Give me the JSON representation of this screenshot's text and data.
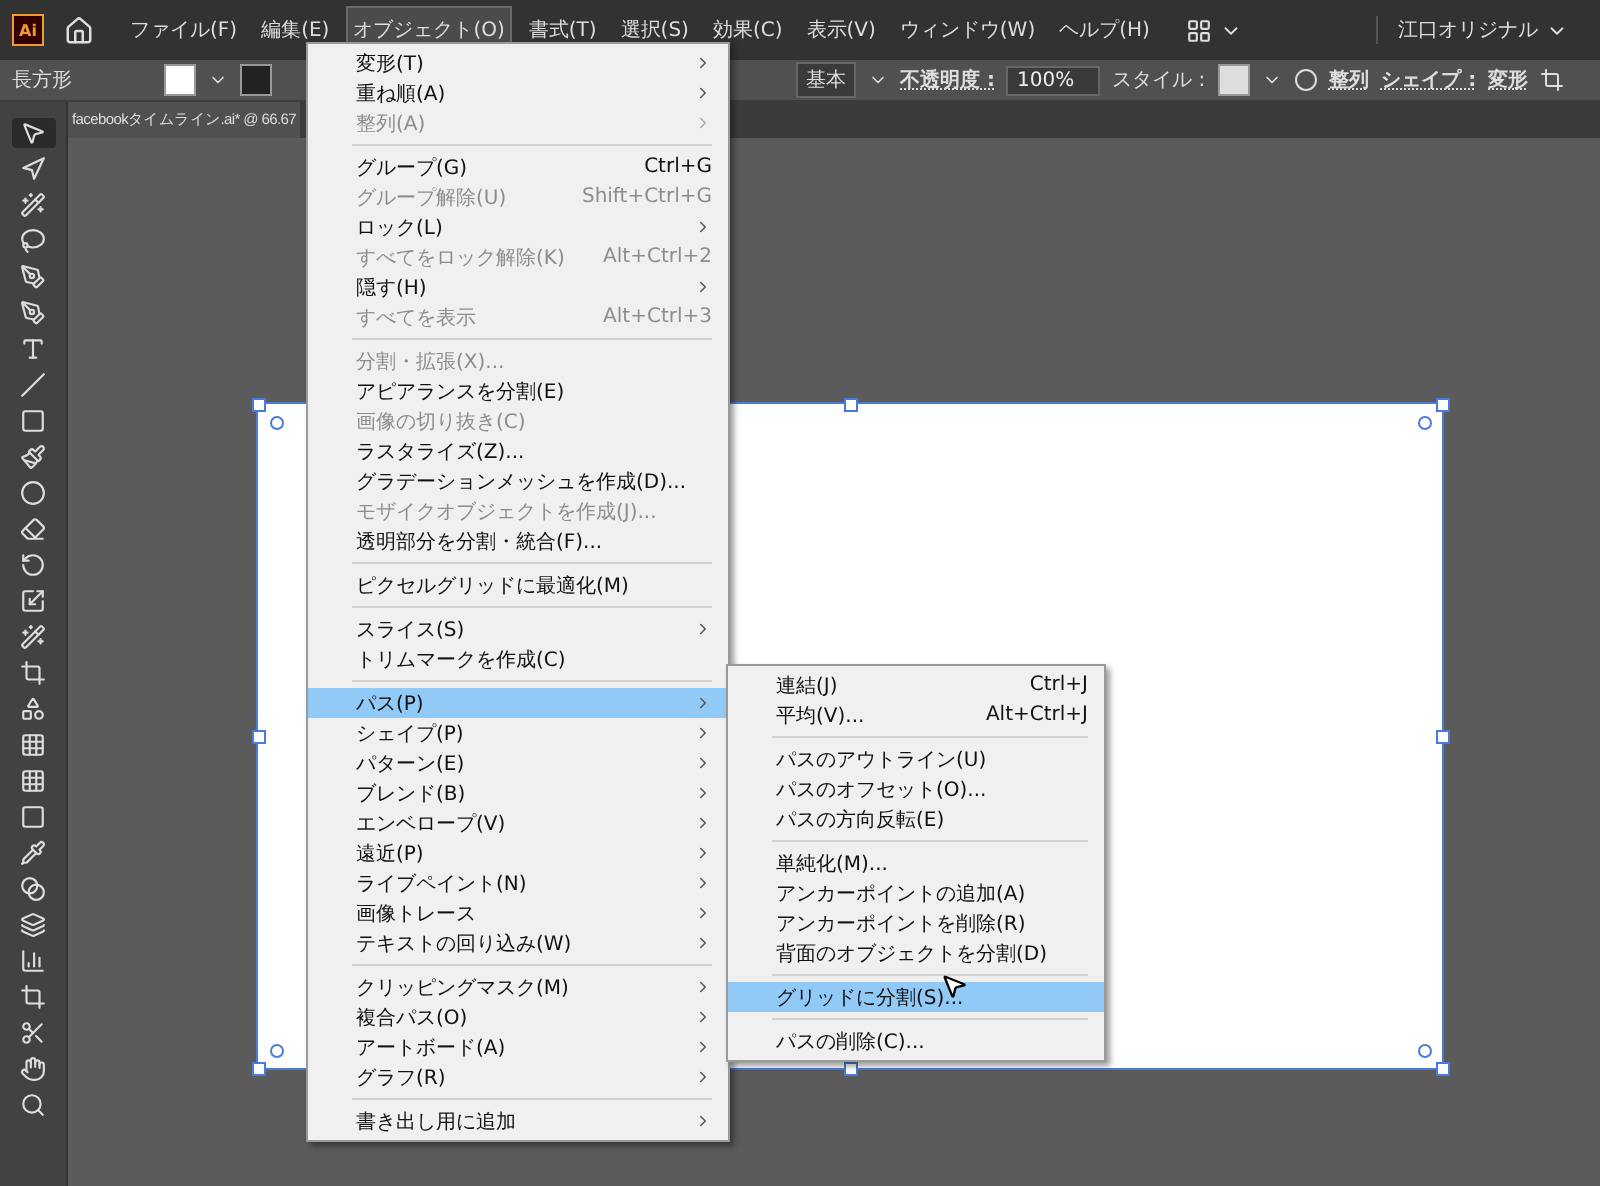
{
  "app_logo": "Ai",
  "menubar": {
    "menus": [
      {
        "label": "ファイル(F)",
        "selected": false
      },
      {
        "label": "編集(E)",
        "selected": false
      },
      {
        "label": "オブジェクト(O)",
        "selected": true
      },
      {
        "label": "書式(T)",
        "selected": false
      },
      {
        "label": "選択(S)",
        "selected": false
      },
      {
        "label": "効果(C)",
        "selected": false
      },
      {
        "label": "表示(V)",
        "selected": false
      },
      {
        "label": "ウィンドウ(W)",
        "selected": false
      },
      {
        "label": "ヘルプ(H)",
        "selected": false
      }
    ],
    "workspace": "江口オリジナル"
  },
  "control_bar": {
    "tool_name": "長方形",
    "brush": "基本",
    "opacity_label": "不透明度 :",
    "opacity_value": "100%",
    "style_label": "スタイル :",
    "align": "整列",
    "shape": "シェイプ :",
    "transform": "変形"
  },
  "document_tab": {
    "title": "facebookタイムライン.ai* @ 66.67"
  },
  "object_menu": [
    {
      "kind": "item",
      "label": "変形(T)",
      "submenu": true,
      "disabled": false,
      "selected": false
    },
    {
      "kind": "item",
      "label": "重ね順(A)",
      "submenu": true,
      "disabled": false,
      "selected": false
    },
    {
      "kind": "item",
      "label": "整列(A)",
      "submenu": true,
      "disabled": true,
      "selected": false
    },
    {
      "kind": "separator"
    },
    {
      "kind": "item",
      "label": "グループ(G)",
      "shortcut": "Ctrl+G",
      "disabled": false,
      "selected": false
    },
    {
      "kind": "item",
      "label": "グループ解除(U)",
      "shortcut": "Shift+Ctrl+G",
      "disabled": true,
      "selected": false
    },
    {
      "kind": "item",
      "label": "ロック(L)",
      "submenu": true,
      "disabled": false,
      "selected": false
    },
    {
      "kind": "item",
      "label": "すべてをロック解除(K)",
      "shortcut": "Alt+Ctrl+2",
      "disabled": true,
      "selected": false
    },
    {
      "kind": "item",
      "label": "隠す(H)",
      "submenu": true,
      "disabled": false,
      "selected": false
    },
    {
      "kind": "item",
      "label": "すべてを表示",
      "shortcut": "Alt+Ctrl+3",
      "disabled": true,
      "selected": false
    },
    {
      "kind": "separator"
    },
    {
      "kind": "item",
      "label": "分割・拡張(X)...",
      "disabled": true,
      "selected": false
    },
    {
      "kind": "item",
      "label": "アピアランスを分割(E)",
      "disabled": false,
      "selected": false
    },
    {
      "kind": "item",
      "label": "画像の切り抜き(C)",
      "disabled": true,
      "selected": false
    },
    {
      "kind": "item",
      "label": "ラスタライズ(Z)...",
      "disabled": false,
      "selected": false
    },
    {
      "kind": "item",
      "label": "グラデーションメッシュを作成(D)...",
      "disabled": false,
      "selected": false
    },
    {
      "kind": "item",
      "label": "モザイクオブジェクトを作成(J)...",
      "disabled": true,
      "selected": false
    },
    {
      "kind": "item",
      "label": "透明部分を分割・統合(F)...",
      "disabled": false,
      "selected": false
    },
    {
      "kind": "separator"
    },
    {
      "kind": "item",
      "label": "ピクセルグリッドに最適化(M)",
      "disabled": false,
      "selected": false
    },
    {
      "kind": "separator"
    },
    {
      "kind": "item",
      "label": "スライス(S)",
      "submenu": true,
      "disabled": false,
      "selected": false
    },
    {
      "kind": "item",
      "label": "トリムマークを作成(C)",
      "disabled": false,
      "selected": false
    },
    {
      "kind": "separator"
    },
    {
      "kind": "item",
      "label": "パス(P)",
      "submenu": true,
      "disabled": false,
      "selected": true
    },
    {
      "kind": "item",
      "label": "シェイプ(P)",
      "submenu": true,
      "disabled": false,
      "selected": false
    },
    {
      "kind": "item",
      "label": "パターン(E)",
      "submenu": true,
      "disabled": false,
      "selected": false
    },
    {
      "kind": "item",
      "label": "ブレンド(B)",
      "submenu": true,
      "disabled": false,
      "selected": false
    },
    {
      "kind": "item",
      "label": "エンベロープ(V)",
      "submenu": true,
      "disabled": false,
      "selected": false
    },
    {
      "kind": "item",
      "label": "遠近(P)",
      "submenu": true,
      "disabled": false,
      "selected": false
    },
    {
      "kind": "item",
      "label": "ライブペイント(N)",
      "submenu": true,
      "disabled": false,
      "selected": false
    },
    {
      "kind": "item",
      "label": "画像トレース",
      "submenu": true,
      "disabled": false,
      "selected": false
    },
    {
      "kind": "item",
      "label": "テキストの回り込み(W)",
      "submenu": true,
      "disabled": false,
      "selected": false
    },
    {
      "kind": "separator"
    },
    {
      "kind": "item",
      "label": "クリッピングマスク(M)",
      "submenu": true,
      "disabled": false,
      "selected": false
    },
    {
      "kind": "item",
      "label": "複合パス(O)",
      "submenu": true,
      "disabled": false,
      "selected": false
    },
    {
      "kind": "item",
      "label": "アートボード(A)",
      "submenu": true,
      "disabled": false,
      "selected": false
    },
    {
      "kind": "item",
      "label": "グラフ(R)",
      "submenu": true,
      "disabled": false,
      "selected": false
    },
    {
      "kind": "separator"
    },
    {
      "kind": "item",
      "label": "書き出し用に追加",
      "submenu": true,
      "disabled": false,
      "selected": false
    }
  ],
  "path_submenu": [
    {
      "kind": "item",
      "label": "連結(J)",
      "shortcut": "Ctrl+J",
      "selected": false
    },
    {
      "kind": "item",
      "label": "平均(V)...",
      "shortcut": "Alt+Ctrl+J",
      "selected": false
    },
    {
      "kind": "separator"
    },
    {
      "kind": "item",
      "label": "パスのアウトライン(U)",
      "selected": false
    },
    {
      "kind": "item",
      "label": "パスのオフセット(O)...",
      "selected": false
    },
    {
      "kind": "item",
      "label": "パスの方向反転(E)",
      "selected": false
    },
    {
      "kind": "separator"
    },
    {
      "kind": "item",
      "label": "単純化(M)...",
      "selected": false
    },
    {
      "kind": "item",
      "label": "アンカーポイントの追加(A)",
      "selected": false
    },
    {
      "kind": "item",
      "label": "アンカーポイントを削除(R)",
      "selected": false
    },
    {
      "kind": "item",
      "label": "背面のオブジェクトを分割(D)",
      "selected": false
    },
    {
      "kind": "separator"
    },
    {
      "kind": "item",
      "label": "グリッドに分割(S)...",
      "selected": true
    },
    {
      "kind": "separator"
    },
    {
      "kind": "item",
      "label": "パスの削除(C)...",
      "selected": false
    }
  ]
}
